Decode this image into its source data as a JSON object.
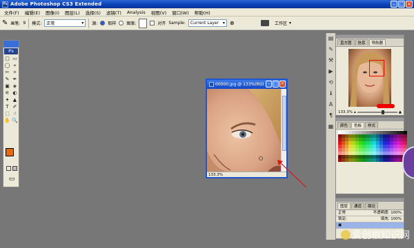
{
  "window": {
    "title": "Adobe Photoshop CS3 Extended",
    "logo": "Ps"
  },
  "menu": [
    "文件(F)",
    "编辑(E)",
    "图像(I)",
    "图层(L)",
    "选择(S)",
    "滤镜(T)",
    "Analysis",
    "视图(V)",
    "窗口(W)",
    "帮助(H)"
  ],
  "options": {
    "brush_label": "画笔:",
    "brush_size": "9",
    "mode_label": "模式:",
    "mode_value": "正常",
    "source_label": "源:",
    "sampled": "取样",
    "pattern": "图案:",
    "aligned": "对齐",
    "sample_label": "Sample:",
    "sample_value": "Current Layer",
    "workspace": "工作区"
  },
  "toolbox": {
    "badge": "Ps",
    "tools": [
      "□",
      "▭",
      "◯",
      "⌖",
      "✂",
      "⌗",
      "✎",
      "✒",
      "▣",
      "◈",
      "⚟",
      "◐",
      "✦",
      "▲",
      "T",
      "✐",
      "⬚",
      "☝",
      "✋",
      "🔍"
    ]
  },
  "document": {
    "title": "00000.jpg @ 133%(RGB/8)",
    "zoom_status": "133.3%"
  },
  "navigator": {
    "tabs": [
      "直方图",
      "信息",
      "导航器"
    ],
    "active_tab": 2,
    "zoom": "133.3%"
  },
  "swatches": {
    "tabs": [
      "颜色",
      "色板",
      "样式"
    ],
    "active_tab": 1
  },
  "layers": {
    "tabs": [
      "图层",
      "通道",
      "路径"
    ],
    "active_tab": 0,
    "blend_mode": "正常",
    "opacity_label": "不透明度:",
    "opacity": "100%",
    "lock_label": "锁定:",
    "fill_label": "填充:",
    "fill": "100%"
  },
  "watermark": "爱创根知识网",
  "colors": {
    "foreground": "#e86a10",
    "background": "#000000",
    "accent": "#1f56cf"
  },
  "icons": [
    "brush-icon",
    "camera-icon",
    "hand-icon",
    "zoom-icon"
  ]
}
